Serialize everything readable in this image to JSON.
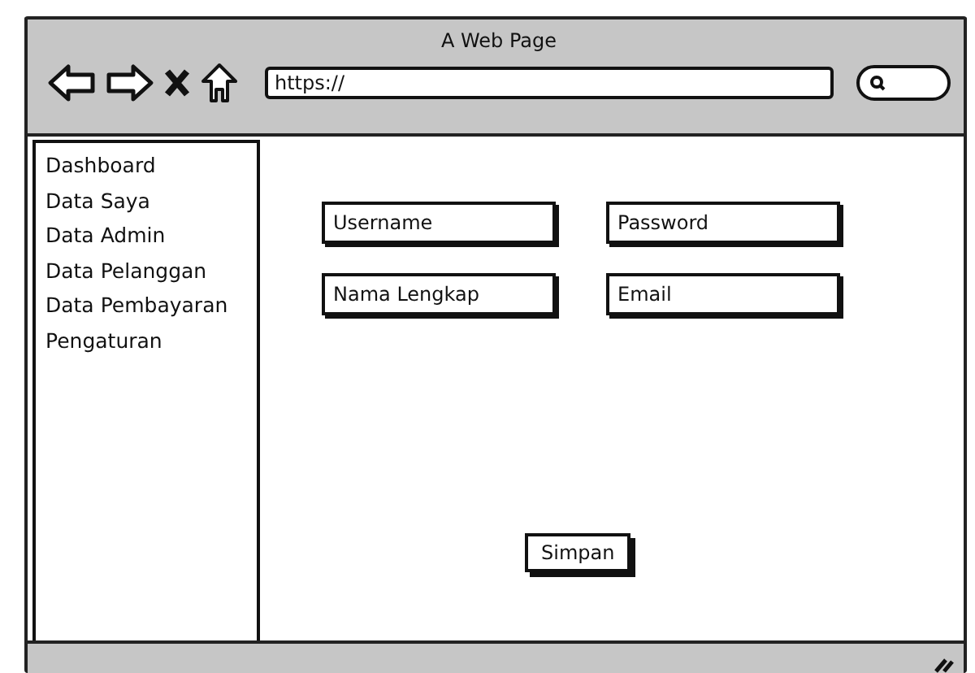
{
  "window": {
    "title": "A Web Page"
  },
  "browser": {
    "url": "https://"
  },
  "sidebar": {
    "items": [
      {
        "label": "Dashboard"
      },
      {
        "label": "Data Saya"
      },
      {
        "label": "Data Admin"
      },
      {
        "label": "Data Pelanggan"
      },
      {
        "label": "Data Pembayaran"
      },
      {
        "label": "Pengaturan"
      }
    ]
  },
  "form": {
    "fields": [
      {
        "placeholder": "Username"
      },
      {
        "placeholder": "Password"
      },
      {
        "placeholder": "Nama Lengkap"
      },
      {
        "placeholder": "Email"
      }
    ],
    "button": "Simpan"
  }
}
